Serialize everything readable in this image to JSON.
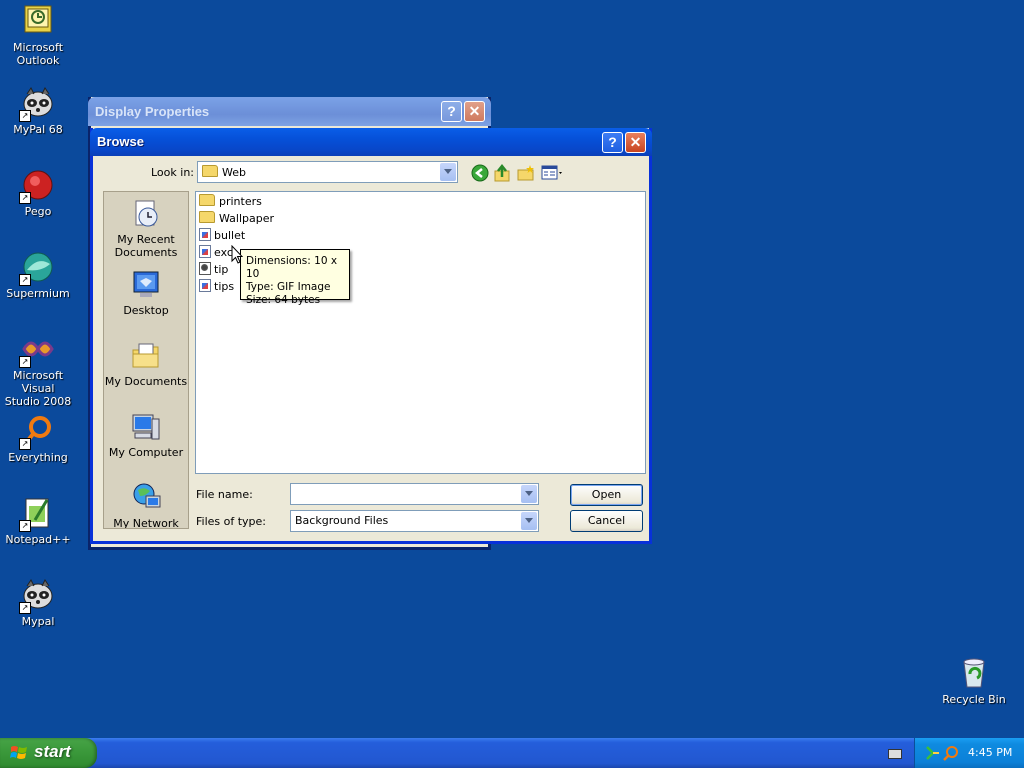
{
  "desktop": {
    "icons": [
      {
        "label": "Microsoft\nOutlook"
      },
      {
        "label": "MyPal 68"
      },
      {
        "label": "Pego"
      },
      {
        "label": "Supermium"
      },
      {
        "label": "Microsoft Visual\nStudio 2008"
      },
      {
        "label": "Everything"
      },
      {
        "label": "Notepad++"
      },
      {
        "label": "Mypal"
      }
    ],
    "recycle_bin": {
      "label": "Recycle Bin"
    }
  },
  "display_properties": {
    "title": "Display Properties",
    "help": "?",
    "close": "✕"
  },
  "browse": {
    "title": "Browse",
    "help": "?",
    "close": "✕",
    "look_in_label": "Look in:",
    "look_in_value": "Web",
    "places": [
      {
        "label": "My Recent\nDocuments"
      },
      {
        "label": "Desktop"
      },
      {
        "label": "My Documents"
      },
      {
        "label": "My Computer"
      },
      {
        "label": "My Network"
      }
    ],
    "files": [
      {
        "name": "printers",
        "type": "folder"
      },
      {
        "name": "Wallpaper",
        "type": "folder"
      },
      {
        "name": "bullet",
        "type": "image"
      },
      {
        "name": "exc",
        "type": "image"
      },
      {
        "name": "tip",
        "type": "cmd"
      },
      {
        "name": "tips",
        "type": "image"
      }
    ],
    "tooltip": {
      "dimensions": "Dimensions: 10 x 10",
      "type": "Type: GIF Image",
      "size": "Size: 64 bytes"
    },
    "file_name_label": "File name:",
    "file_name_value": "",
    "files_of_type_label": "Files of type:",
    "files_of_type_value": "Background Files",
    "open_label": "Open",
    "cancel_label": "Cancel"
  },
  "taskbar": {
    "start_label": "start",
    "clock": "4:45 PM"
  },
  "colors": {
    "desktop": "#0b4a9c",
    "title_active": "#0a5ee8",
    "taskbar": "#245edb",
    "start_button": "#3c9a3c",
    "tooltip_bg": "#ffffe1"
  }
}
